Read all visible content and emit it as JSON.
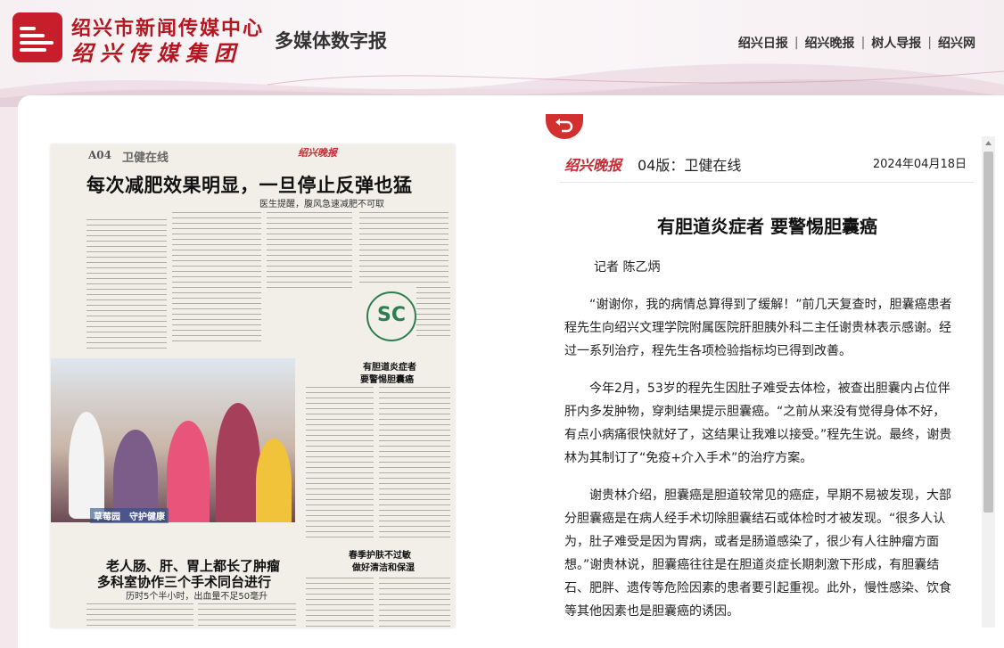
{
  "header": {
    "org_name": "绍兴市新闻传媒中心",
    "group_name": "绍兴传媒集团",
    "product_name": "多媒体数字报",
    "nav": [
      "绍兴日报",
      "绍兴晚报",
      "树人导报",
      "绍兴网"
    ]
  },
  "paper_page": {
    "page_no": "A04",
    "section": "卫健在线",
    "masthead": "绍兴晚报",
    "headline": "每次减肥效果明显，一旦停止反弹也猛",
    "subhead": "医生提醒，腹风急速减肥不可取",
    "photo_caption": "草莓园　守护健康",
    "headline2_line1": "老人肠、肝、胃上都长了肿瘤",
    "headline2_line2": "多科室协作三个手术同台进行",
    "subhead2": "历时5个半小时，出血量不足50毫升",
    "box1_line1": "有胆道炎症者",
    "box1_line2": "要警惕胆囊癌",
    "box2_line1": "春季护肤不过敏",
    "box2_line2": "做好清洁和保湿"
  },
  "article": {
    "masthead": "绍兴晚报",
    "page_label": "04版：卫健在线",
    "date": "2024年04月18日",
    "title": "有胆道炎症者 要警惕胆囊癌",
    "byline": "记者 陈乙炳",
    "paragraphs": [
      "“谢谢你，我的病情总算得到了缓解！”前几天复查时，胆囊癌患者程先生向绍兴文理学院附属医院肝胆胰外科二主任谢贵林表示感谢。经过一系列治疗，程先生各项检验指标均已得到改善。",
      "今年2月，53岁的程先生因肚子难受去体检，被查出胆囊内占位伴肝内多发肿物，穿刺结果提示胆囊癌。“之前从来没有觉得身体不好，有点小病痛很快就好了，这结果让我难以接受。”程先生说。最终，谢贵林为其制订了“免疫+介入手术”的治疗方案。",
      "谢贵林介绍，胆囊癌是胆道较常见的癌症，早期不易被发现，大部分胆囊癌是在病人经手术切除胆囊结石或体检时才被发现。“很多人认为，肚子难受是因为胃病，或者是肠道感染了，很少有人往肿瘤方面想。”谢贵林说，胆囊癌往往是在胆道炎症长期刺激下形成，有胆囊结石、肥胖、遗传等危险因素的患者要引起重视。此外，慢性感染、饮食等其他因素也是胆囊癌的诱因。"
    ]
  },
  "colors": {
    "brand_red": "#c81e2c",
    "back_button": "#d32f2f"
  }
}
